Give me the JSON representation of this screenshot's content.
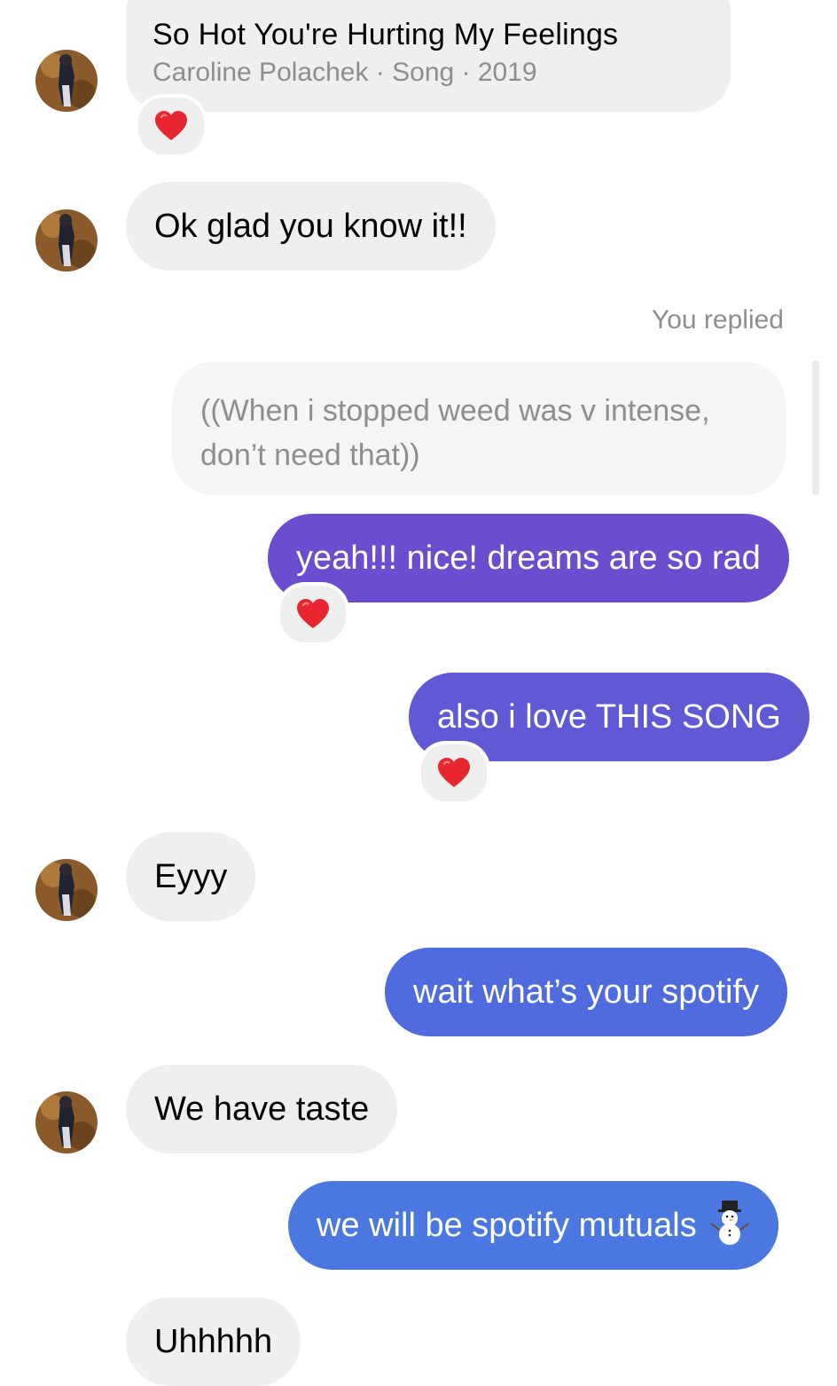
{
  "conversation": {
    "song_card": {
      "title": "So Hot You're Hurting My Feelings",
      "subtitle": "Caroline Polachek · Song · 2019",
      "reaction": "heart"
    },
    "messages": [
      {
        "id": "m1",
        "sender": "them",
        "text": "Ok glad you know it!!"
      },
      {
        "id": "m2",
        "sender": "me",
        "text": "yeah!!! nice! dreams are so rad",
        "color": "#6c4dd0",
        "reaction": "heart"
      },
      {
        "id": "m3",
        "sender": "me",
        "text": "also i love THIS SONG",
        "color": "#5f59d6",
        "reaction": "heart"
      },
      {
        "id": "m4",
        "sender": "them",
        "text": "Eyyy"
      },
      {
        "id": "m5",
        "sender": "me",
        "text": "wait what’s your spotify",
        "color": "#4f6bde"
      },
      {
        "id": "m6",
        "sender": "them",
        "text": "We have taste"
      },
      {
        "id": "m7",
        "sender": "me",
        "text": "we will be spotify mutuals",
        "color": "#4a78e0",
        "emoji": "snowman-icon"
      },
      {
        "id": "m8",
        "sender": "them",
        "text": "Uhhhhh"
      }
    ],
    "reply": {
      "label": "You replied",
      "quoted_line1": "((When i stopped weed was v intense,",
      "quoted_line2": "don’t need that))"
    }
  },
  "colors": {
    "incoming_bubble": "#efefef",
    "quoted_bubble": "#f5f5f5",
    "secondary_text": "#8e8e8e",
    "heart": "#e8262f"
  }
}
